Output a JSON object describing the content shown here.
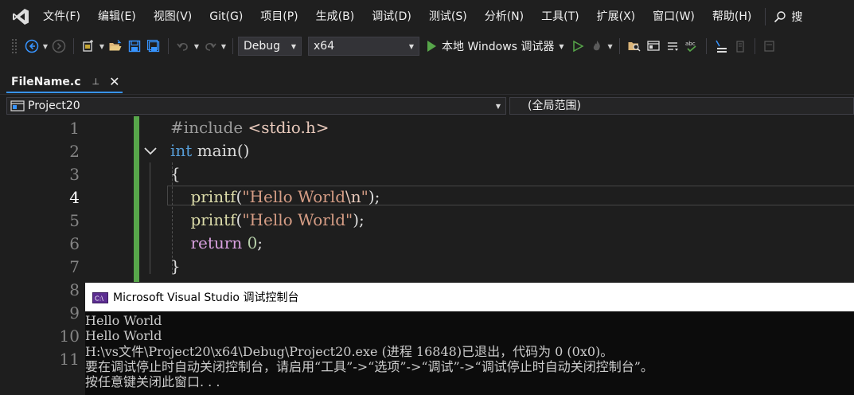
{
  "menu": {
    "items": [
      "文件(F)",
      "编辑(E)",
      "视图(V)",
      "Git(G)",
      "项目(P)",
      "生成(B)",
      "调试(D)",
      "测试(S)",
      "分析(N)",
      "工具(T)",
      "扩展(X)",
      "窗口(W)",
      "帮助(H)"
    ],
    "search_label": "搜"
  },
  "toolbar": {
    "config": "Debug",
    "platform": "x64",
    "start_label": "本地 Windows 调试器"
  },
  "tab": {
    "title": "FileName.c",
    "pin_glyph": "⊥",
    "close_glyph": "✕"
  },
  "navbar": {
    "project": "Project20",
    "scope": "(全局范围)"
  },
  "editor": {
    "line_numbers": [
      "1",
      "2",
      "3",
      "4",
      "5",
      "6",
      "7",
      "8",
      "9",
      "10",
      "11"
    ],
    "current_line": 4,
    "code": {
      "line1_directive": "#include",
      "line1_header": "<stdio.h>",
      "line2_type": "int",
      "line2_name": "main",
      "line2_parens": "()",
      "line3": "{",
      "line4_fn": "printf",
      "line4_open": "(",
      "line4_str": "\"Hello World",
      "line4_esc": "\\n",
      "line4_strend": "\"",
      "line4_close": ");",
      "line5_fn": "printf",
      "line5_open": "(",
      "line5_str": "\"Hello World\"",
      "line5_close": ");",
      "line6_kw": "return",
      "line6_num": "0",
      "line6_semi": ";",
      "line7": "}"
    }
  },
  "console": {
    "title": "Microsoft Visual Studio 调试控制台",
    "lines": [
      "Hello World",
      "Hello World",
      "H:\\vs文件\\Project20\\x64\\Debug\\Project20.exe (进程 16848)已退出，代码为 0 (0x0)。",
      "要在调试停止时自动关闭控制台，请启用“工具”->“选项”->“调试”->“调试停止时自动关闭控制台”。",
      "按任意键关闭此窗口. . ."
    ]
  },
  "colors": {
    "accent_tab": "#3794ff",
    "change_bar": "#57a64a",
    "keyword": "#569cd6",
    "function": "#dcdcaa",
    "string": "#d69d85",
    "control_keyword": "#d8a0df",
    "number": "#b5cea8"
  }
}
